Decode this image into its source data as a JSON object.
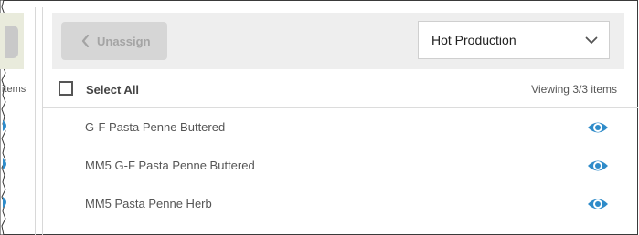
{
  "left_panel": {
    "items_fragment": "items"
  },
  "toolbar": {
    "unassign_label": "Unassign",
    "dropdown_value": "Hot Production"
  },
  "list_header": {
    "select_all_label": "Select All",
    "viewing_text": "Viewing 3/3 items"
  },
  "items": [
    {
      "label": "G-F Pasta Penne Buttered",
      "icon": "eye-icon"
    },
    {
      "label": "MM5 G-F Pasta Penne Buttered",
      "icon": "eye-icon"
    },
    {
      "label": "MM5 Pasta Penne Herb",
      "icon": "eye-icon"
    }
  ],
  "colors": {
    "accent_blue": "#2e8bc9",
    "toolbar_bg": "#eeeeee",
    "disabled_button_bg": "#d6d6d6",
    "disabled_button_text": "#a4a4a4"
  }
}
